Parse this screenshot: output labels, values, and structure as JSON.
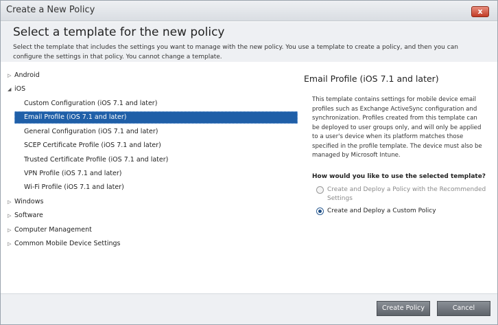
{
  "window": {
    "title": "Create a New Policy",
    "close_label": "x"
  },
  "header": {
    "title": "Select a template for the new policy",
    "description": "Select the template that includes the settings you want to manage with the new policy. You use a template to create a policy, and then you can configure the settings in that policy. You cannot change a template."
  },
  "tree": {
    "android": "Android",
    "ios": "iOS",
    "ios_children": [
      "Custom Configuration (iOS 7.1 and later)",
      "Email Profile (iOS 7.1 and later)",
      "General Configuration (iOS 7.1 and later)",
      "SCEP Certificate Profile (iOS 7.1 and later)",
      "Trusted Certificate Profile (iOS 7.1 and later)",
      "VPN Profile (iOS 7.1 and later)",
      "Wi-Fi Profile (iOS 7.1 and later)"
    ],
    "windows": "Windows",
    "software": "Software",
    "computer_management": "Computer Management",
    "common_mobile": "Common Mobile Device Settings",
    "selected": "Email Profile (iOS 7.1 and later)"
  },
  "details": {
    "title": "Email Profile (iOS 7.1 and later)",
    "description": "This template contains settings for mobile device email profiles such as Exchange ActiveSync configuration and synchronization. Profiles created from this template can be deployed to user groups only, and will only be applied to a user's device when its platform matches those specified in the profile template. The device must also be managed by Microsoft Intune.",
    "question": "How would you like to use the selected template?",
    "option_recommended": "Create and Deploy a Policy with the Recommended Settings",
    "option_custom": "Create and Deploy a Custom Policy"
  },
  "footer": {
    "create_label": "Create Policy",
    "cancel_label": "Cancel"
  }
}
